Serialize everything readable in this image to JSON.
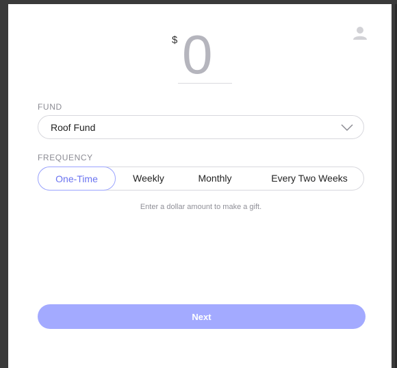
{
  "amount": {
    "currency": "$",
    "value": "0"
  },
  "fund": {
    "label": "FUND",
    "selected": "Roof Fund"
  },
  "frequency": {
    "label": "FREQUENCY",
    "options": [
      "One-Time",
      "Weekly",
      "Monthly",
      "Every Two Weeks"
    ],
    "selected": "One-Time"
  },
  "hint": "Enter a dollar amount to make a gift.",
  "actions": {
    "next_label": "Next"
  },
  "icons": {
    "user": "user-icon",
    "dropdown": "chevron-down-icon"
  },
  "colors": {
    "accent": "#a3aaff",
    "active_text": "#6a73f0",
    "amount_text": "#b5b5bd"
  }
}
